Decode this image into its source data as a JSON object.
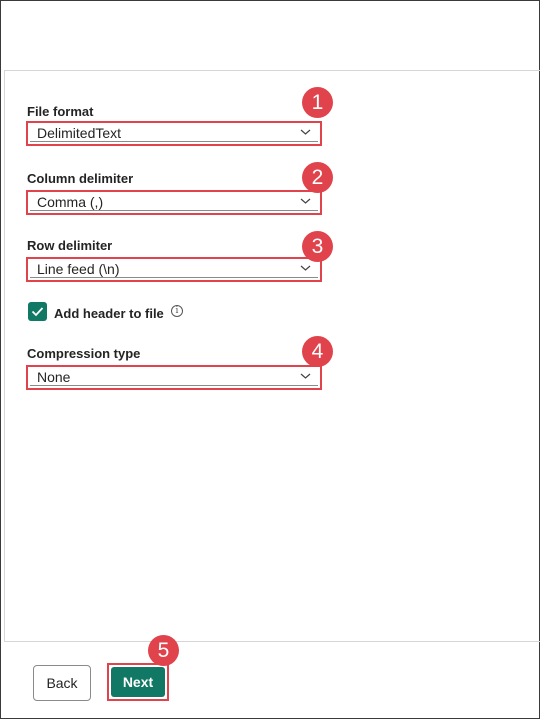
{
  "form": {
    "file_format": {
      "label": "File format",
      "value": "DelimitedText",
      "badge": "1"
    },
    "column_delimiter": {
      "label": "Column delimiter",
      "value": "Comma (,)",
      "badge": "2"
    },
    "row_delimiter": {
      "label": "Row delimiter",
      "value": "Line feed (\\n)",
      "badge": "3"
    },
    "add_header": {
      "label": "Add header to file",
      "checked": true,
      "info_icon": "info-icon"
    },
    "compression_type": {
      "label": "Compression type",
      "value": "None",
      "badge": "4"
    }
  },
  "footer": {
    "back_label": "Back",
    "next_label": "Next",
    "next_badge": "5"
  },
  "colors": {
    "accent": "#117865",
    "highlight": "#e0434b"
  }
}
